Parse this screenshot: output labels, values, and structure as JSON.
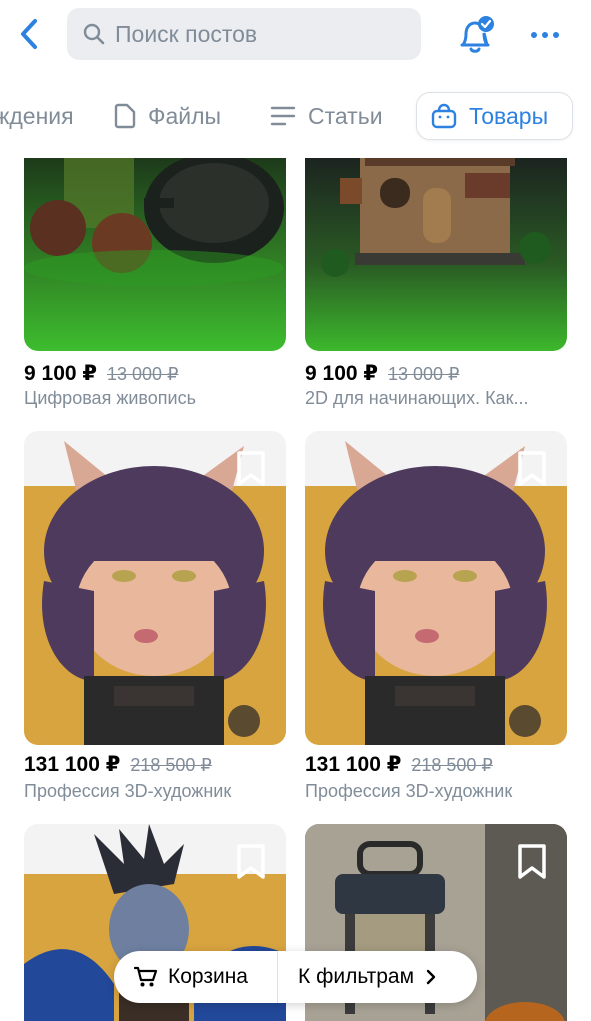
{
  "search": {
    "placeholder": "Поиск постов"
  },
  "tabs": {
    "partial_label": "ждения",
    "files_label": "Файлы",
    "articles_label": "Статьи",
    "goods_label": "Товары",
    "active": "goods"
  },
  "products": [
    {
      "price": "9 100 ₽",
      "old_price": "13 000 ₽",
      "title": "Цифровая живопись",
      "image": "still-life-teapot-apples"
    },
    {
      "price": "9 100 ₽",
      "old_price": "13 000 ₽",
      "title": "2D для начинающих. Как...",
      "image": "fantasy-house"
    },
    {
      "price": "131 100 ₽",
      "old_price": "218 500 ₽",
      "title": "Профессия 3D-художник",
      "image": "cat-girl-character"
    },
    {
      "price": "131 100 ₽",
      "old_price": "218 500 ₽",
      "title": "Профессия 3D-художник",
      "image": "cat-girl-character"
    },
    {
      "price": "",
      "old_price": "",
      "title": "",
      "image": "dark-hero-character"
    },
    {
      "price": "",
      "old_price": "",
      "title": "",
      "image": "lantern-still-life"
    }
  ],
  "bottom_bar": {
    "cart_label": "Корзина",
    "filters_label": "К фильтрам"
  },
  "colors": {
    "accent": "#2d81e0",
    "secondary_text": "#818c99",
    "search_bg": "#ebedf0"
  },
  "icons": [
    "back-chevron-icon",
    "search-icon",
    "bell-icon",
    "more-icon",
    "file-icon",
    "article-icon",
    "bag-icon",
    "bookmark-icon",
    "cart-icon",
    "chevron-right-icon"
  ]
}
